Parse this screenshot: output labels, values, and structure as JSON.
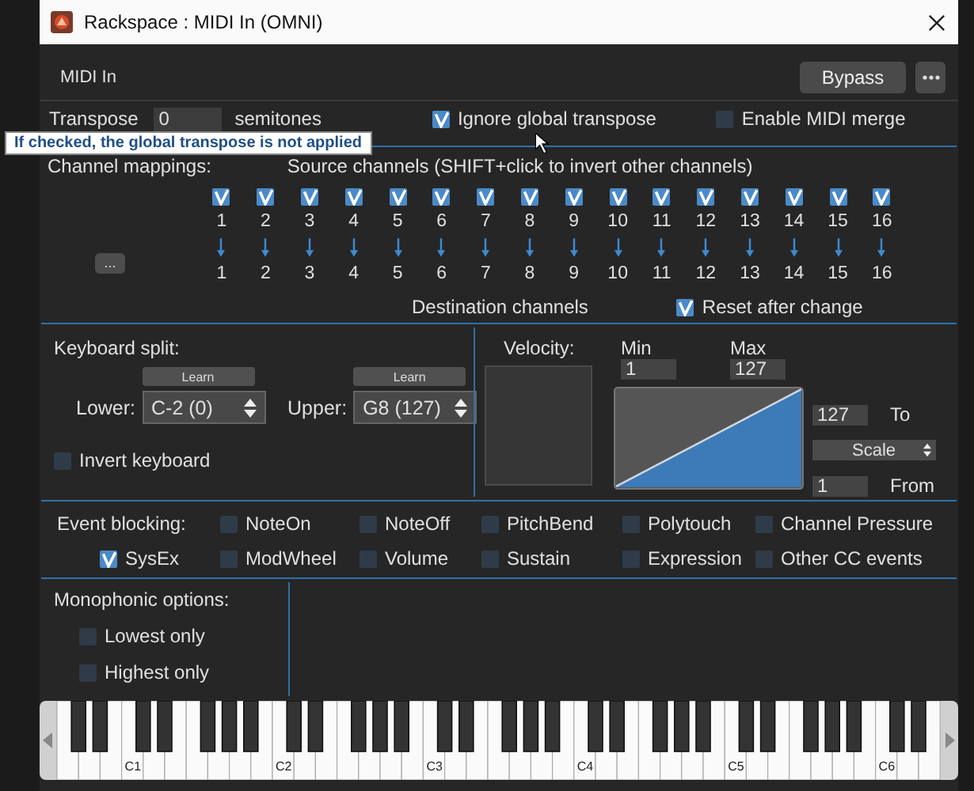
{
  "window": {
    "title": "Rackspace : MIDI In (OMNI)"
  },
  "header": {
    "plugin_name": "MIDI In",
    "bypass": "Bypass"
  },
  "transpose": {
    "label": "Transpose",
    "value": "0",
    "unit": "semitones"
  },
  "tooltip": "If checked, the global transpose is not applied",
  "options": [
    {
      "label": "Ignore global transpose",
      "checked": true
    },
    {
      "label": "Enable MIDI merge",
      "checked": false
    }
  ],
  "channel_mappings": {
    "label": "Channel mappings:",
    "source_label": "Source channels (SHIFT+click to invert other channels)",
    "more_button": "...",
    "channels": [
      {
        "source": "1",
        "dest": "1",
        "checked": true
      },
      {
        "source": "2",
        "dest": "2",
        "checked": true
      },
      {
        "source": "3",
        "dest": "3",
        "checked": true
      },
      {
        "source": "4",
        "dest": "4",
        "checked": true
      },
      {
        "source": "5",
        "dest": "5",
        "checked": true
      },
      {
        "source": "6",
        "dest": "6",
        "checked": true
      },
      {
        "source": "7",
        "dest": "7",
        "checked": true
      },
      {
        "source": "8",
        "dest": "8",
        "checked": true
      },
      {
        "source": "9",
        "dest": "9",
        "checked": true
      },
      {
        "source": "10",
        "dest": "10",
        "checked": true
      },
      {
        "source": "11",
        "dest": "11",
        "checked": true
      },
      {
        "source": "12",
        "dest": "12",
        "checked": true
      },
      {
        "source": "13",
        "dest": "13",
        "checked": true
      },
      {
        "source": "14",
        "dest": "14",
        "checked": true
      },
      {
        "source": "15",
        "dest": "15",
        "checked": true
      },
      {
        "source": "16",
        "dest": "16",
        "checked": true
      }
    ],
    "dest_label": "Destination channels",
    "reset": {
      "label": "Reset after change",
      "checked": true
    }
  },
  "keyboard_split": {
    "label": "Keyboard split:",
    "ranges": [
      {
        "label": "Lower:",
        "learn": "Learn",
        "value": "C-2 (0)"
      },
      {
        "label": "Upper:",
        "learn": "Learn",
        "value": "G8 (127)"
      }
    ],
    "invert": {
      "label": "Invert keyboard",
      "checked": false
    }
  },
  "velocity": {
    "label": "Velocity:",
    "min_label": "Min",
    "min": "1",
    "max_label": "Max",
    "max": "127",
    "to": "127",
    "to_label": "To",
    "mode": "Scale",
    "from": "1",
    "from_label": "From"
  },
  "event_blocking": {
    "label": "Event blocking:",
    "rows": [
      [
        "",
        {
          "label": "NoteOn",
          "checked": false
        },
        {
          "label": "NoteOff",
          "checked": false
        },
        {
          "label": "PitchBend",
          "checked": false
        },
        {
          "label": "Polytouch",
          "checked": false
        },
        {
          "label": "Channel Pressure",
          "checked": false
        }
      ],
      [
        {
          "label": "SysEx",
          "checked": true
        },
        {
          "label": "ModWheel",
          "checked": false
        },
        {
          "label": "Volume",
          "checked": false
        },
        {
          "label": "Sustain",
          "checked": false
        },
        {
          "label": "Expression",
          "checked": false
        },
        {
          "label": "Other CC events",
          "checked": false
        }
      ]
    ]
  },
  "monophonic": {
    "label": "Monophonic options:",
    "options": [
      {
        "label": "Lowest only",
        "checked": false
      },
      {
        "label": "Highest only",
        "checked": false
      }
    ]
  },
  "keyboard": {
    "octave_labels": [
      "C1",
      "C2",
      "C3",
      "C4",
      "C5",
      "C6"
    ]
  }
}
